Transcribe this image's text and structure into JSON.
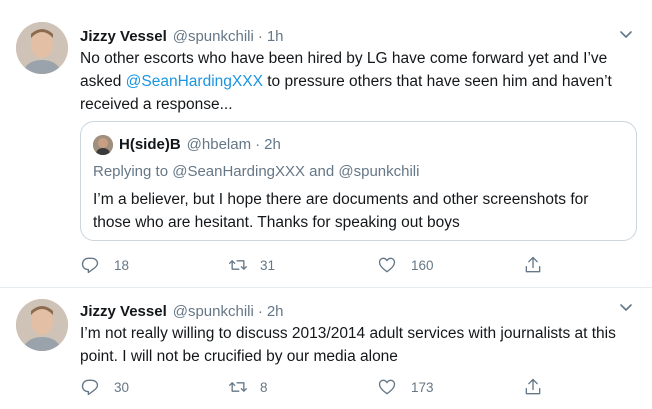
{
  "colors": {
    "link": "#1b95e0",
    "secondary": "#657786",
    "text": "#14171a",
    "border": "#e6ecf0"
  },
  "tweets": [
    {
      "author_name": "Jizzy Vessel",
      "handle": "@spunkchili",
      "separator": "·",
      "time": "1h",
      "text_before": "No other escorts who have been hired by LG have come forward yet and I’ve asked ",
      "mention": "@SeanHardingXXX",
      "text_after": " to pressure others that have seen him and haven’t received a response...",
      "quote": {
        "author_name": "H(side)B",
        "handle": "@hbelam",
        "separator": "·",
        "time": "2h",
        "replying": "Replying to @SeanHardingXXX and @spunkchili",
        "text": "I’m a believer, but I hope there are documents and other screenshots for those who are hesitant. Thanks for speaking out boys"
      },
      "actions": {
        "replies": "18",
        "retweets": "31",
        "likes": "160"
      },
      "icons": {
        "reply": "reply-icon",
        "retweet": "retweet-icon",
        "like": "heart-icon",
        "share": "share-icon",
        "menu": "chevron-down-icon"
      }
    },
    {
      "author_name": "Jizzy Vessel",
      "handle": "@spunkchili",
      "separator": "·",
      "time": "2h",
      "text": "I’m not really willing to discuss 2013/2014 adult services with journalists at this point. I will not be crucified by our media alone",
      "actions": {
        "replies": "30",
        "retweets": "8",
        "likes": "173"
      },
      "icons": {
        "reply": "reply-icon",
        "retweet": "retweet-icon",
        "like": "heart-icon",
        "share": "share-icon",
        "menu": "chevron-down-icon"
      }
    }
  ]
}
